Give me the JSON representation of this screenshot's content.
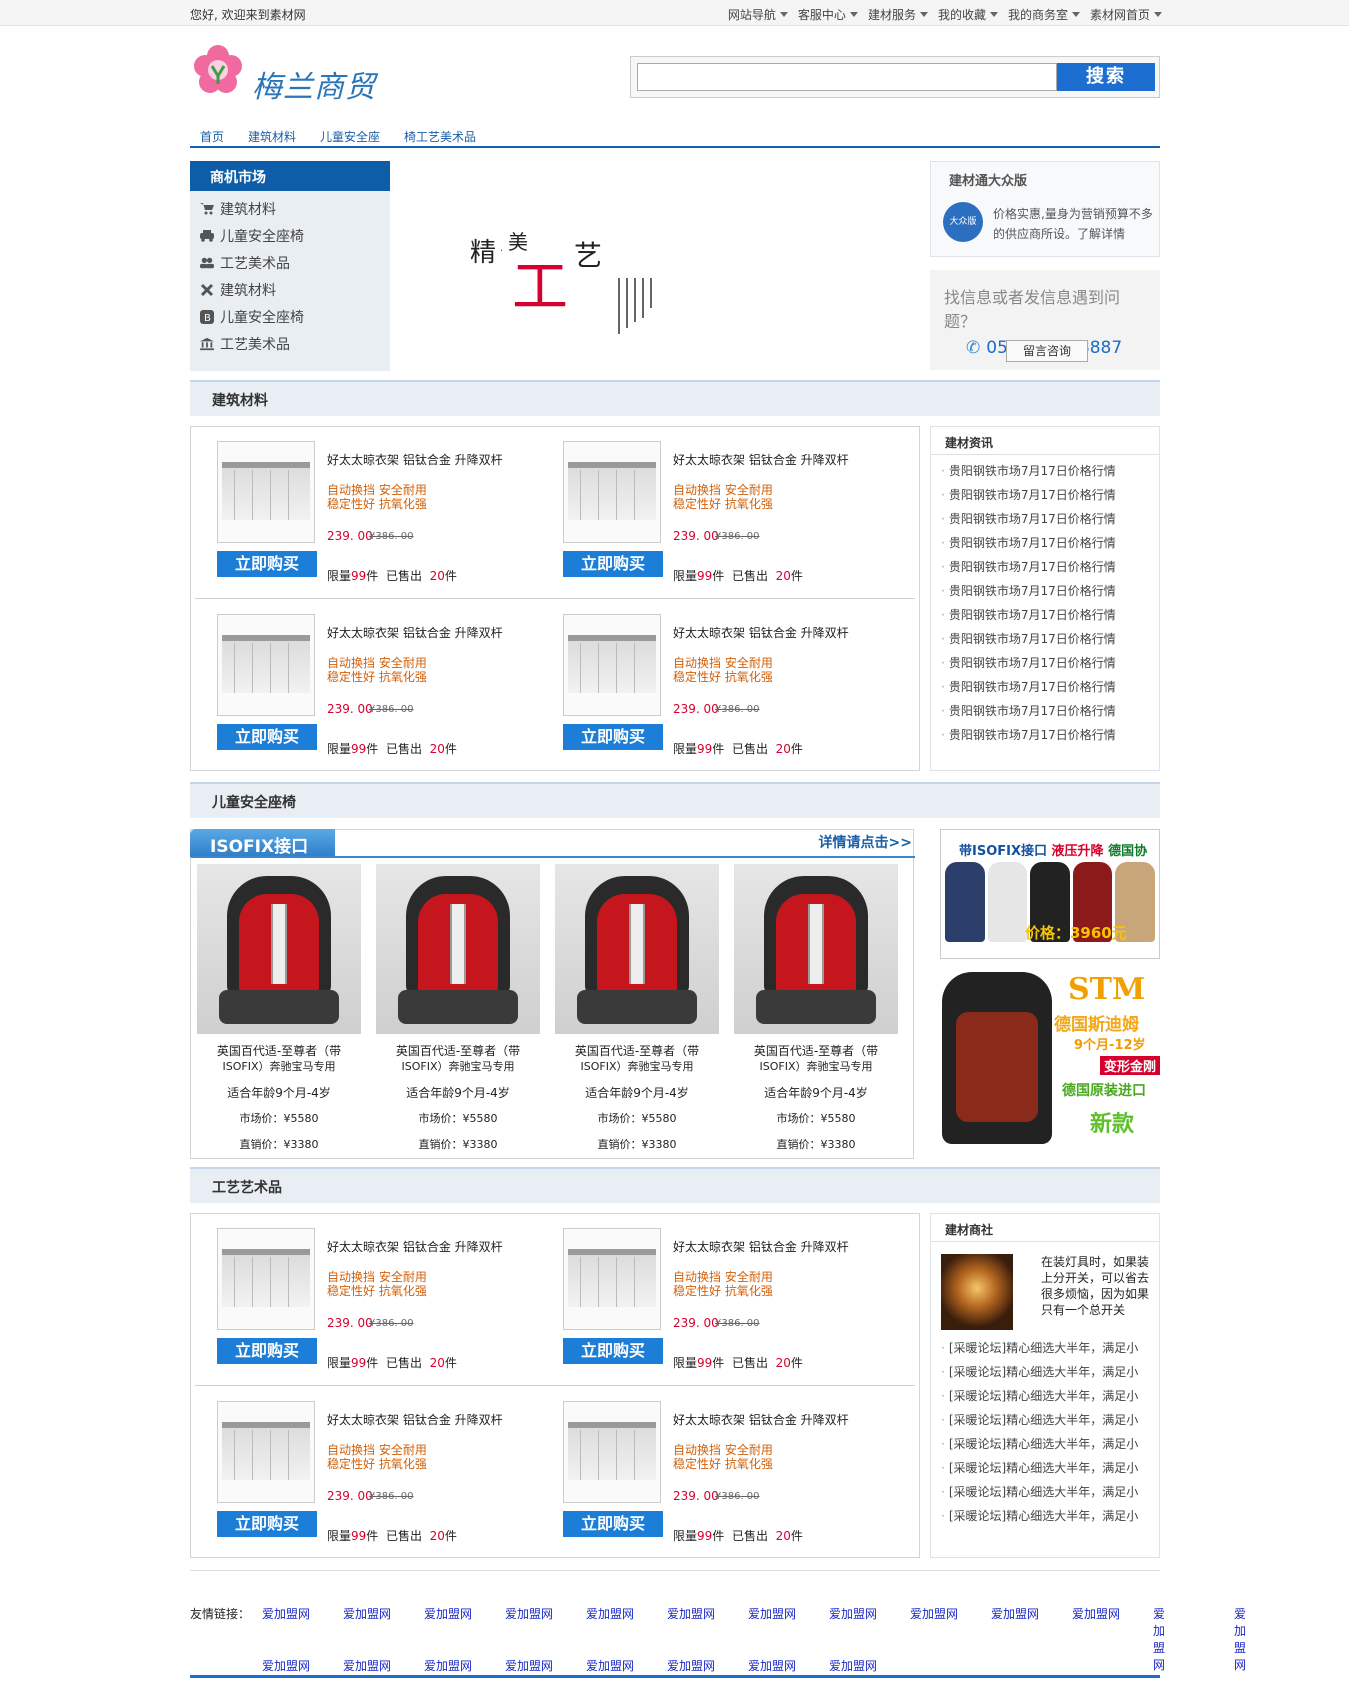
{
  "topbar": {
    "welcome": "您好, 欢迎来到素材网",
    "nav": [
      "网站导航",
      "客服中心",
      "建材服务",
      "我的收藏",
      "我的商务室",
      "素材网首页"
    ]
  },
  "logo": {
    "text": "梅兰商贸"
  },
  "search": {
    "button": "搜索",
    "placeholder": ""
  },
  "mainnav": [
    "首页",
    "建筑材料",
    "儿童安全座",
    "椅工艺美术品"
  ],
  "sidebar": {
    "title": "商机市场",
    "items": [
      {
        "label": "建筑材料",
        "icon": "cart-icon"
      },
      {
        "label": "儿童安全座椅",
        "icon": "car-icon"
      },
      {
        "label": "工艺美术品",
        "icon": "users-icon"
      },
      {
        "label": "建筑材料",
        "icon": "tools-icon"
      },
      {
        "label": "儿童安全座椅",
        "icon": "blogger-icon"
      },
      {
        "label": "工艺美术品",
        "icon": "bank-icon"
      }
    ]
  },
  "banner": {
    "c1": "精",
    "c2": "美",
    "c3": "工",
    "c4": "艺"
  },
  "info_box": {
    "title": "建材通大众版",
    "badge": "大众版",
    "desc": "价格实惠,量身为营销预算不多的供应商所设。了解详情"
  },
  "help_box": {
    "question": "找信息或者发信息遇到问题？",
    "phone": "0571-89938887",
    "message_button": "留言咨询"
  },
  "sections": {
    "s1": "建筑材料",
    "s2": "儿童安全座椅",
    "s3": "工艺艺术品"
  },
  "product": {
    "title": "好太太晾衣架 铝钛合金 升降双杆",
    "feature1": "自动换挡 安全耐用",
    "feature2": "稳定性好 抗氧化强",
    "price": "239. 00",
    "old_price": "¥386. 00",
    "buy": "立即购买",
    "limit_label": "限量",
    "limit_num": "99",
    "limit_unit": "件",
    "sold_label": "已售出",
    "sold_num": "20",
    "sold_unit": "件"
  },
  "news": {
    "title": "建材资讯",
    "items": [
      "贵阳钢铁市场7月17日价格行情",
      "贵阳钢铁市场7月17日价格行情",
      "贵阳钢铁市场7月17日价格行情",
      "贵阳钢铁市场7月17日价格行情",
      "贵阳钢铁市场7月17日价格行情",
      "贵阳钢铁市场7月17日价格行情",
      "贵阳钢铁市场7月17日价格行情",
      "贵阳钢铁市场7月17日价格行情",
      "贵阳钢铁市场7月17日价格行情",
      "贵阳钢铁市场7月17日价格行情",
      "贵阳钢铁市场7月17日价格行情",
      "贵阳钢铁市场7月17日价格行情"
    ]
  },
  "seats": {
    "tab": "ISOFIX接口",
    "more": "详情请点击>>",
    "name1": "英国百代适-至尊者（带",
    "name2": "ISOFIX）奔驰宝马专用",
    "age": "适合年龄9个月-4岁",
    "market": "市场价：¥5580",
    "direct": "直销价：¥3380"
  },
  "ad1": {
    "a": "带ISOFIX接口",
    "b": "液压升降",
    "c": "德国协和",
    "price": "价格：3960元"
  },
  "ad2": {
    "stm": "STM",
    "l1": "德国斯迪姆",
    "l2": "9个月-12岁",
    "l3": "变形金刚",
    "l4": "德国原装进口",
    "l5": "新款"
  },
  "forum": {
    "title": "建材商社",
    "intro": "在装灯具时，如果装上分开关，可以省去很多烦恼，因为如果只有一个总开关",
    "items": [
      "[采暖论坛]精心细选大半年，满足小",
      "[采暖论坛]精心细选大半年，满足小",
      "[采暖论坛]精心细选大半年，满足小",
      "[采暖论坛]精心细选大半年，满足小",
      "[采暖论坛]精心细选大半年，满足小",
      "[采暖论坛]精心细选大半年，满足小",
      "[采暖论坛]精心细选大半年，满足小",
      "[采暖论坛]精心细选大半年，满足小"
    ]
  },
  "links": {
    "label": "友情链接：",
    "item": "爱加盟网"
  }
}
